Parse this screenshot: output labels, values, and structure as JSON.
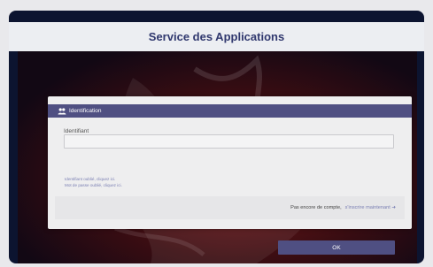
{
  "header": {
    "title": "Service des Applications"
  },
  "panel": {
    "title": "Identification",
    "title_icon": "users-icon",
    "field_label": "Identifiant",
    "field_value": "",
    "ok_label": "OK",
    "forgot_id": "Identifiant oublié, cliquez ici.",
    "forgot_password": "Mot de passe oublié, cliquez ici.",
    "no_account_text": "Pas encore de compte,",
    "register_link": "s'inscrire maintenant",
    "register_icon": "sign-in-icon"
  },
  "colors": {
    "header_bg": "#eceef2",
    "title_color": "#30386e",
    "accent": "#4f4f82",
    "link": "#7a7fb3",
    "frame_bg": "#0c1430"
  }
}
